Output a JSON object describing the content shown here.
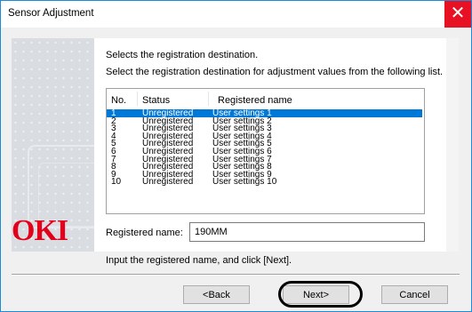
{
  "window": {
    "title": "Sensor Adjustment",
    "close_glyph": "✕"
  },
  "banner": {
    "logo_text": "OKI"
  },
  "content": {
    "heading": "Selects the registration destination.",
    "subheading": "Select the registration destination for adjustment values from the following list.",
    "columns": [
      "No.",
      "Status",
      "Registered name"
    ],
    "rows": [
      {
        "no": "1",
        "status": "Unregistered",
        "name": "User settings 1",
        "selected": true
      },
      {
        "no": "2",
        "status": "Unregistered",
        "name": "User settings 2"
      },
      {
        "no": "3",
        "status": "Unregistered",
        "name": "User settings 3"
      },
      {
        "no": "4",
        "status": "Unregistered",
        "name": "User settings 4"
      },
      {
        "no": "5",
        "status": "Unregistered",
        "name": "User settings 5"
      },
      {
        "no": "6",
        "status": "Unregistered",
        "name": "User settings 6"
      },
      {
        "no": "7",
        "status": "Unregistered",
        "name": "User settings 7"
      },
      {
        "no": "8",
        "status": "Unregistered",
        "name": "User settings 8"
      },
      {
        "no": "9",
        "status": "Unregistered",
        "name": "User settings 9"
      },
      {
        "no": "10",
        "status": "Unregistered",
        "name": "User settings 10"
      }
    ],
    "registered_name_label": "Registered name:",
    "registered_name_value": "190MM"
  },
  "instruction": "Input the registered name, and click [Next].",
  "buttons": {
    "back": "<Back",
    "next": "Next>",
    "cancel": "Cancel"
  },
  "colors": {
    "selection": "#0078d7",
    "close": "#e81123",
    "logo": "#e2001a"
  }
}
